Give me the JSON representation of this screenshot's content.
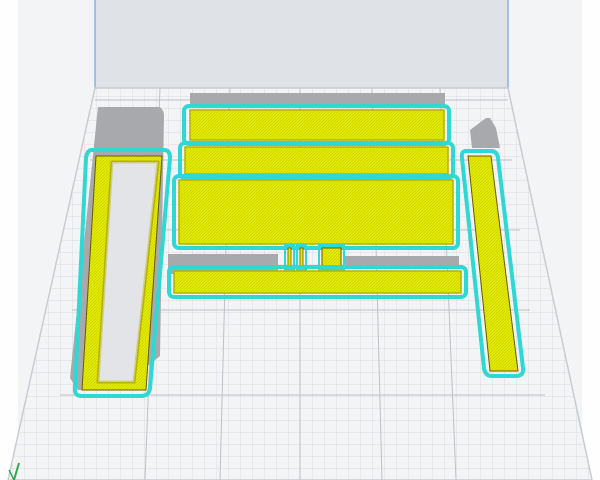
{
  "viewport": {
    "background_color": "#e9ebee",
    "build_plate": {
      "surface_color": "#f3f4f5",
      "grid_minor_color": "#d2d5da",
      "grid_major_color": "#b9bdc4",
      "frame_color": "#c8ccd2",
      "volume_edge_color": "#7fa7e6"
    },
    "colors": {
      "infill": "#e4ec00",
      "infill_texture": "#c2c800",
      "skirt": "#30d8d4",
      "skirt_outer": "#1fb9b5",
      "inner_wall": "#b7b100",
      "outer_wall_dark": "#6a5a00",
      "shadow": "#a7a9ad"
    },
    "parts": [
      {
        "name": "top-long-panel",
        "label": ""
      },
      {
        "name": "middle-long-panel",
        "label": ""
      },
      {
        "name": "large-panel",
        "label": ""
      },
      {
        "name": "bottom-long-panel",
        "label": ""
      },
      {
        "name": "left-frame-panel",
        "label": ""
      },
      {
        "name": "right-vertical-panel",
        "label": ""
      },
      {
        "name": "small-square-tab",
        "label": ""
      },
      {
        "name": "thin-tab-a",
        "label": ""
      },
      {
        "name": "thin-tab-b",
        "label": ""
      }
    ],
    "axis_indicator": {
      "icon": "axis-gizmo-icon",
      "color": "#2ea84f"
    }
  }
}
